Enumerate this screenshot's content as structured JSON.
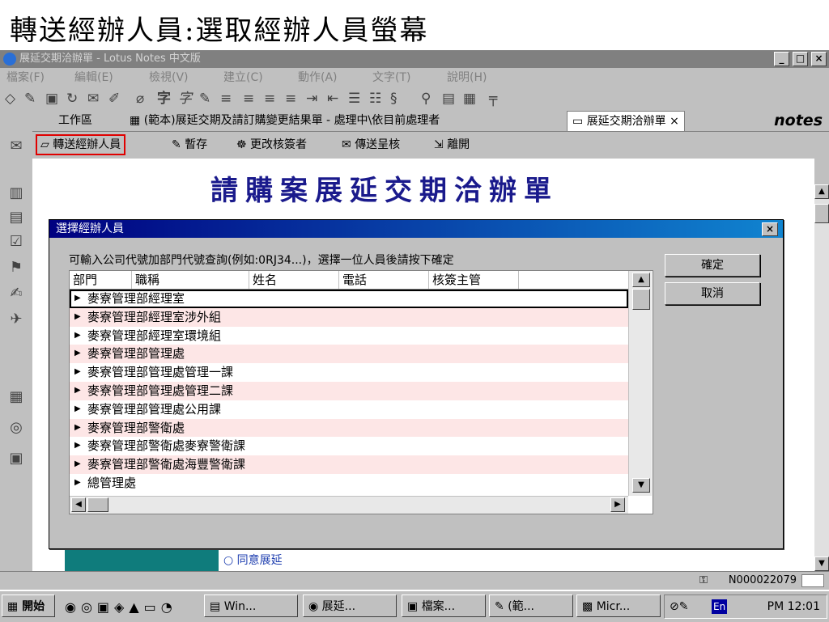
{
  "slide_title": "轉送經辦人員:選取經辦人員螢幕",
  "window": {
    "title": "展延交期洽辦單 - Lotus Notes 中文版",
    "minimize": "_",
    "maximize": "□",
    "close": "×"
  },
  "menu": [
    "檔案(F)",
    "編輯(E)",
    "檢視(V)",
    "建立(C)",
    "動作(A)",
    "文字(T)",
    "說明(H)"
  ],
  "tabs": {
    "workspace": "工作區",
    "doc1": "(範本)展延交期及請訂購變更結果單 - 處理中\\依目前處理者",
    "active": "展延交期洽辦單",
    "active_close": "×",
    "logo": "notes"
  },
  "actions": {
    "transfer": "轉送經辦人員",
    "save": "暫存",
    "change_signer": "更改核簽者",
    "send_review": "傳送呈核",
    "exit": "離開"
  },
  "document": {
    "title": "請購案展延交期洽辦單",
    "radio_label": "同意展延"
  },
  "dialog": {
    "title": "選擇經辦人員",
    "close": "×",
    "instruction": "可輸入公司代號加部門代號查詢(例如:0RJ34...)，選擇一位人員後請按下確定",
    "ok": "確定",
    "cancel": "取消",
    "columns": [
      "部門",
      "職稱",
      "姓名",
      "電話",
      "核簽主管"
    ],
    "rows": [
      "麥寮管理部經理室",
      "麥寮管理部經理室涉外組",
      "麥寮管理部經理室環境組",
      "麥寮管理部管理處",
      "麥寮管理部管理處管理一課",
      "麥寮管理部管理處管理二課",
      "麥寮管理部管理處公用課",
      "麥寮管理部警衛處",
      "麥寮管理部警衛處麥寮警衛課",
      "麥寮管理部警衛處海豐警衛課",
      "總管理處"
    ]
  },
  "status": {
    "id": "N000022079"
  },
  "taskbar": {
    "start": "開始",
    "tasks": [
      "Win...",
      "展延...",
      "檔案...",
      "(範...",
      "Micr..."
    ],
    "lang": "En",
    "clock": "PM 12:01"
  }
}
